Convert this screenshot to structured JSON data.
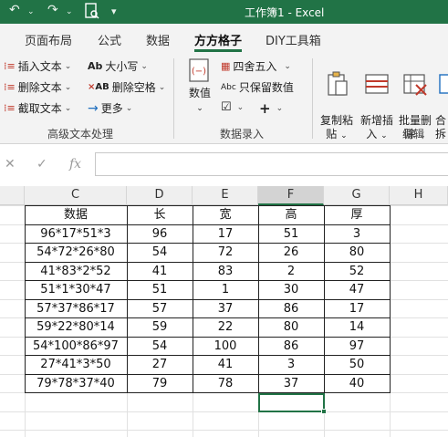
{
  "window": {
    "title": "工作簿1  -  Excel"
  },
  "tabs": [
    {
      "label": "页面布局"
    },
    {
      "label": "公式"
    },
    {
      "label": "数据"
    },
    {
      "label": "方方格子"
    },
    {
      "label": "DIY工具箱"
    }
  ],
  "ribbon": {
    "text_group": {
      "items": [
        "插入文本",
        "删除文本",
        "截取文本"
      ],
      "size_label": "大小写",
      "delete_space_label": "删除空格",
      "more_label": "更多",
      "group_label": "高级文本处理"
    },
    "number_group": {
      "value_label": "数值",
      "round_label": "四舍五入",
      "keep_value_label": "只保留数值",
      "group_label": "数据录入"
    },
    "edit_group": {
      "copy_paste_label": "复制粘\n贴",
      "insert_label": "新增插\n入",
      "batch_delete_label": "批量删\n除",
      "merge_label": "合\n拆",
      "group_label": "编辑"
    }
  },
  "formula_bar": {
    "cancel_symbol": "✕",
    "enter_symbol": "✓",
    "fx_symbol": "fx",
    "value": ""
  },
  "columns": [
    "C",
    "D",
    "E",
    "F",
    "G",
    "H"
  ],
  "table": {
    "headers": [
      "数据",
      "长",
      "宽",
      "高",
      "厚"
    ],
    "rows": [
      [
        "96*17*51*3",
        "96",
        "17",
        "51",
        "3"
      ],
      [
        "54*72*26*80",
        "54",
        "72",
        "26",
        "80"
      ],
      [
        "41*83*2*52",
        "41",
        "83",
        "2",
        "52"
      ],
      [
        "51*1*30*47",
        "51",
        "1",
        "30",
        "47"
      ],
      [
        "57*37*86*17",
        "57",
        "37",
        "86",
        "17"
      ],
      [
        "59*22*80*14",
        "59",
        "22",
        "80",
        "14"
      ],
      [
        "54*100*86*97",
        "54",
        "100",
        "86",
        "97"
      ],
      [
        "27*41*3*50",
        "27",
        "41",
        "3",
        "50"
      ],
      [
        "79*78*37*40",
        "79",
        "78",
        "37",
        "40"
      ]
    ]
  },
  "colors": {
    "accent": "#217346"
  }
}
